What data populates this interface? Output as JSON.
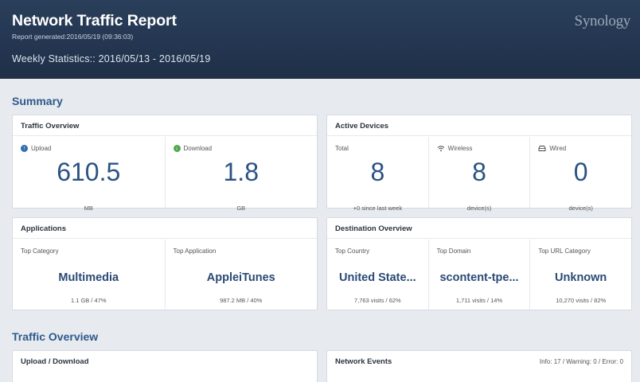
{
  "header": {
    "title": "Network Traffic Report",
    "generated": "Report generated:2016/05/19 (09:36:03)",
    "weekly": "Weekly Statistics:: 2016/05/13 - 2016/05/19",
    "logo": "Synology"
  },
  "summary": {
    "title": "Summary",
    "traffic_overview": {
      "title": "Traffic Overview",
      "upload": {
        "label": "Upload",
        "value": "610.5",
        "unit": "MB",
        "icon": "upload-arrow-icon"
      },
      "download": {
        "label": "Download",
        "value": "1.8",
        "unit": "GB",
        "icon": "download-arrow-icon"
      }
    },
    "active_devices": {
      "title": "Active Devices",
      "total": {
        "label": "Total",
        "value": "8",
        "sub": "+0 since last week"
      },
      "wireless": {
        "label": "Wireless",
        "value": "8",
        "sub": "device(s)",
        "icon": "wifi-icon"
      },
      "wired": {
        "label": "Wired",
        "value": "0",
        "sub": "device(s)",
        "icon": "wired-icon"
      }
    },
    "applications": {
      "title": "Applications",
      "top_category": {
        "label": "Top Category",
        "value": "Multimedia",
        "sub": "1.1 GB / 47%"
      },
      "top_application": {
        "label": "Top Application",
        "value": "AppleiTunes",
        "sub": "987.2 MB / 40%"
      }
    },
    "destination_overview": {
      "title": "Destination Overview",
      "top_country": {
        "label": "Top Country",
        "value": "United State...",
        "sub": "7,763 visits / 62%"
      },
      "top_domain": {
        "label": "Top Domain",
        "value": "scontent-tpe...",
        "sub": "1,711 visits / 14%"
      },
      "top_url_category": {
        "label": "Top URL Category",
        "value": "Unknown",
        "sub": "10,270 visits / 82%"
      }
    }
  },
  "traffic_section": {
    "title": "Traffic Overview",
    "upload_download": {
      "title": "Upload / Download"
    },
    "network_events": {
      "title": "Network Events",
      "counts": "Info: 17 / Warning: 0 / Error: 0"
    }
  },
  "colors": {
    "header_bg": "#243651",
    "accent": "#2b5283",
    "section_title": "#2d5a8a",
    "upload_icon": "#2f6fb0",
    "download_icon": "#4fa84f"
  }
}
